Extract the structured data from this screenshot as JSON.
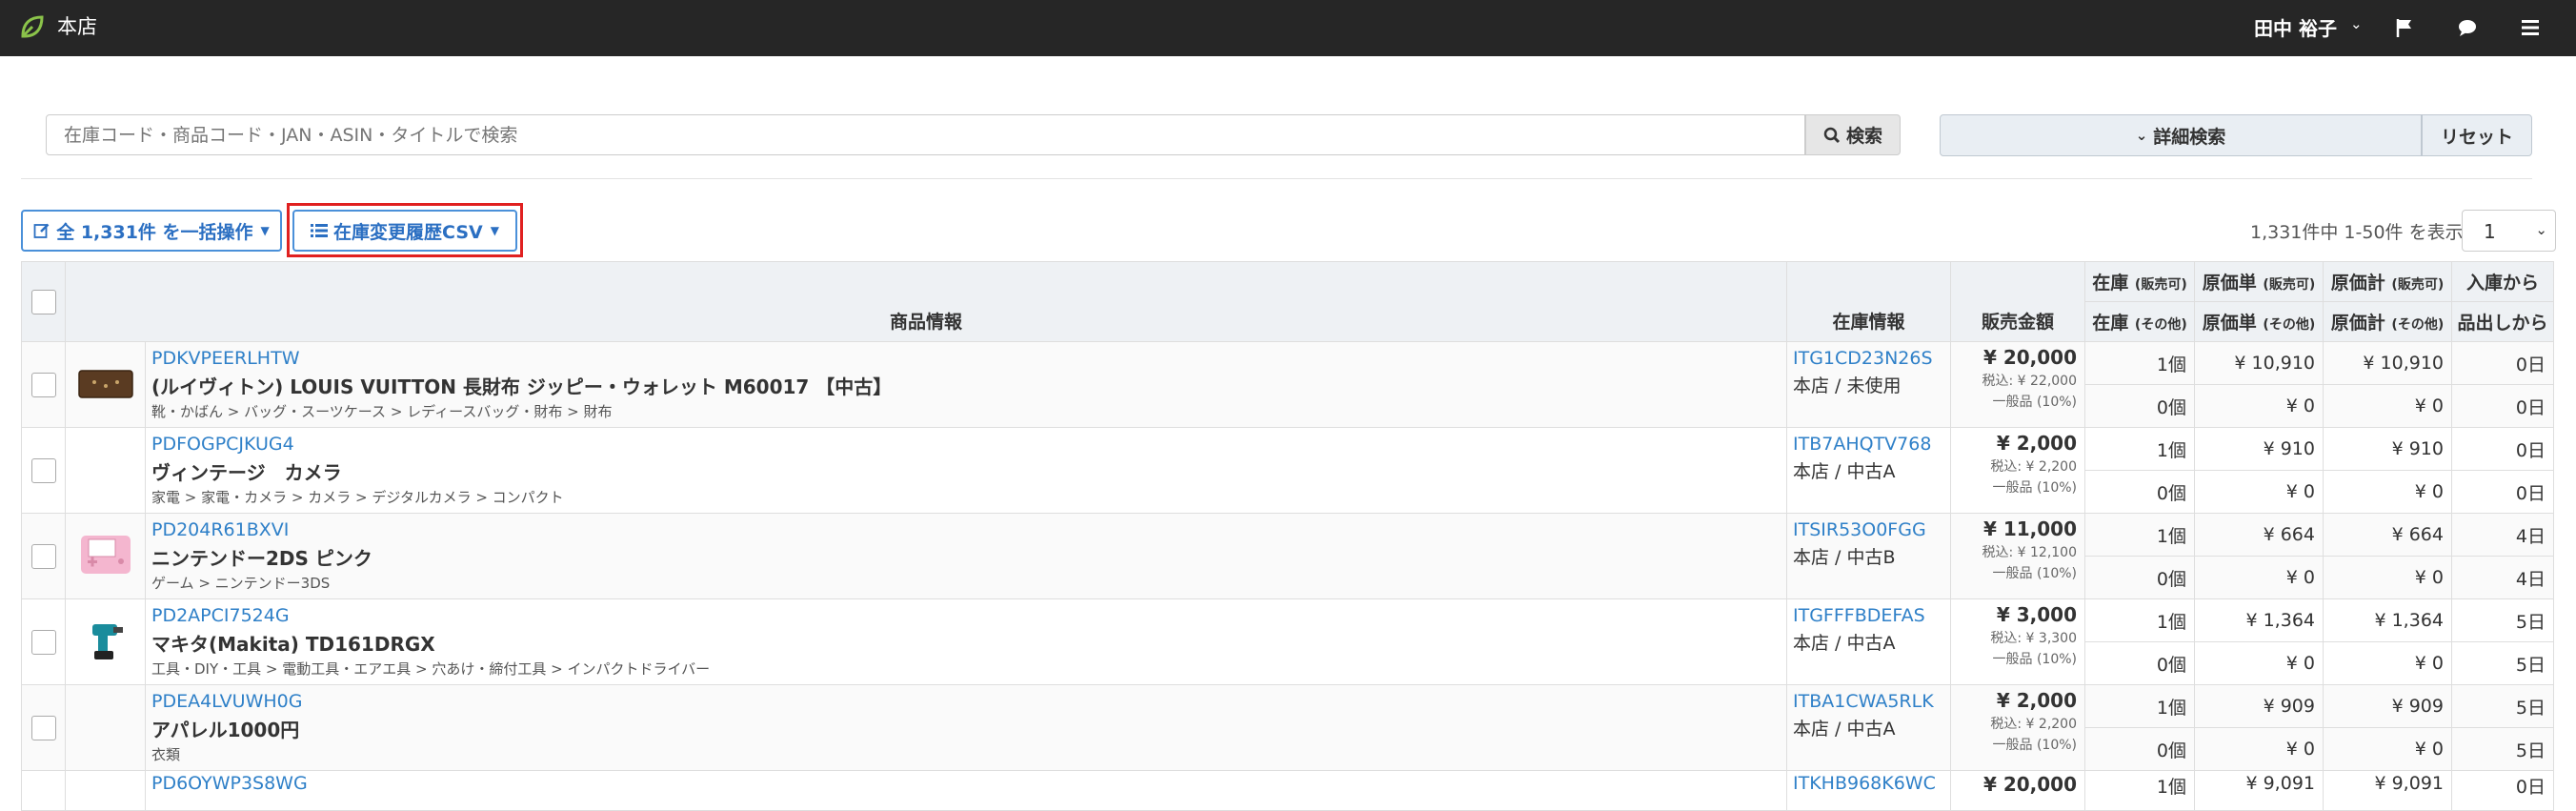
{
  "topbar": {
    "store": "本店",
    "user": "田中 裕子"
  },
  "search": {
    "placeholder": "在庫コード・商品コード・JAN・ASIN・タイトルで検索",
    "button": "検索",
    "advanced": "詳細検索",
    "reset": "リセット"
  },
  "actions": {
    "bulk": "全 1,331件 を一括操作",
    "csv": "在庫変更履歴CSV",
    "count": "1,331件中 1-50件 を表示",
    "page": "1"
  },
  "headers": {
    "product": "商品情報",
    "stock_info": "在庫情報",
    "sale_price": "販売金額",
    "stock": "在庫",
    "stock_sellable": "(販売可)",
    "stock_other": "(その他)",
    "unit_cost": "原価単",
    "total_cost": "原価計",
    "days_a": "入庫から",
    "days_b": "品出しから"
  },
  "rows": [
    {
      "code": "PDKVPEERLHTW",
      "title": "(ルイヴィトン) LOUIS VUITTON 長財布 ジッピー・ウォレット M60017 【中古】",
      "category": "靴・かばん > バッグ・スーツケース > レディースバッグ・財布 > 財布",
      "stock_code": "ITG1CD23N26S",
      "location": "本店 / 未使用",
      "price": "¥ 20,000",
      "tax": "税込: ¥ 22,000",
      "tax_type": "一般品 (10%)",
      "stock1": "1個",
      "cost1": "¥ 10,910",
      "total1": "¥ 10,910",
      "days1": "0日",
      "stock2": "0個",
      "cost2": "¥ 0",
      "total2": "¥ 0",
      "days2": "0日",
      "image": "wallet"
    },
    {
      "code": "PDFOGPCJKUG4",
      "title": "ヴィンテージ　カメラ",
      "category": "家電 > 家電・カメラ > カメラ > デジタルカメラ > コンパクト",
      "stock_code": "ITB7AHQTV768",
      "location": "本店 / 中古A",
      "price": "¥ 2,000",
      "tax": "税込: ¥ 2,200",
      "tax_type": "一般品 (10%)",
      "stock1": "1個",
      "cost1": "¥ 910",
      "total1": "¥ 910",
      "days1": "0日",
      "stock2": "0個",
      "cost2": "¥ 0",
      "total2": "¥ 0",
      "days2": "0日",
      "image": ""
    },
    {
      "code": "PD204R61BXVI",
      "title": "ニンテンドー2DS ピンク",
      "category": "ゲーム > ニンテンドー3DS",
      "stock_code": "ITSIR53O0FGG",
      "location": "本店 / 中古B",
      "price": "¥ 11,000",
      "tax": "税込: ¥ 12,100",
      "tax_type": "一般品 (10%)",
      "stock1": "1個",
      "cost1": "¥ 664",
      "total1": "¥ 664",
      "days1": "4日",
      "stock2": "0個",
      "cost2": "¥ 0",
      "total2": "¥ 0",
      "days2": "4日",
      "image": "console"
    },
    {
      "code": "PD2APCI7524G",
      "title": "マキタ(Makita) TD161DRGX",
      "category": "工具・DIY・工具 > 電動工具・エアエ具 > 穴あけ・締付工具 > インパクトドライバー",
      "stock_code": "ITGFFFBDEFAS",
      "location": "本店 / 中古A",
      "price": "¥ 3,000",
      "tax": "税込: ¥ 3,300",
      "tax_type": "一般品 (10%)",
      "stock1": "1個",
      "cost1": "¥ 1,364",
      "total1": "¥ 1,364",
      "days1": "5日",
      "stock2": "0個",
      "cost2": "¥ 0",
      "total2": "¥ 0",
      "days2": "5日",
      "image": "drill"
    },
    {
      "code": "PDEA4LVUWH0G",
      "title": "アパレル1000円",
      "category": "衣類",
      "stock_code": "ITBA1CWA5RLK",
      "location": "本店 / 中古A",
      "price": "¥ 2,000",
      "tax": "税込: ¥ 2,200",
      "tax_type": "一般品 (10%)",
      "stock1": "1個",
      "cost1": "¥ 909",
      "total1": "¥ 909",
      "days1": "5日",
      "stock2": "0個",
      "cost2": "¥ 0",
      "total2": "¥ 0",
      "days2": "5日",
      "image": ""
    },
    {
      "code": "PD6OYWP3S8WG",
      "stock_code": "ITKHB968K6WC",
      "price": "¥ 20,000",
      "stock1": "1個",
      "cost1": "¥ 9,091",
      "total1": "¥ 9,091",
      "days1": "0日"
    }
  ],
  "colors": {
    "link": "#2f80c8",
    "highlight": "#e02020",
    "topbar": "#262626"
  }
}
